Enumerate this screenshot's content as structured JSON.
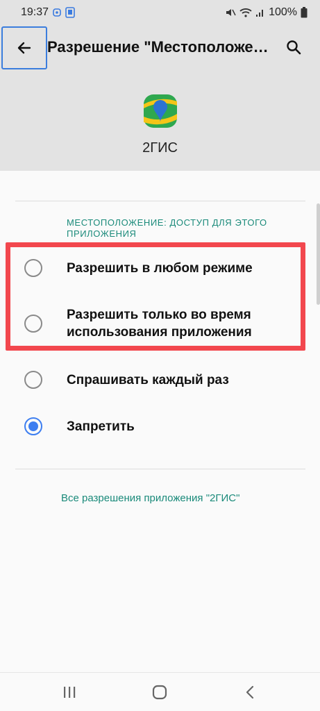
{
  "status_bar": {
    "time": "19:37",
    "battery": "100%"
  },
  "app_bar": {
    "title": "Разрешение \"Местоположение\""
  },
  "app": {
    "name": "2ГИС"
  },
  "section": {
    "label": "МЕСТОПОЛОЖЕНИЕ: ДОСТУП ДЛЯ ЭТОГО ПРИЛОЖЕНИЯ"
  },
  "options": [
    {
      "label": "Разрешить в любом режиме",
      "checked": false
    },
    {
      "label": "Разрешить только во время использования приложения",
      "checked": false
    },
    {
      "label": "Спрашивать каждый раз",
      "checked": false
    },
    {
      "label": "Запретить",
      "checked": true
    }
  ],
  "footer_link": {
    "label": "Все разрешения приложения \"2ГИС\""
  },
  "colors": {
    "accent": "#3d7ef0",
    "teal_text": "#1a8a7a",
    "highlight": "#f2474e"
  }
}
